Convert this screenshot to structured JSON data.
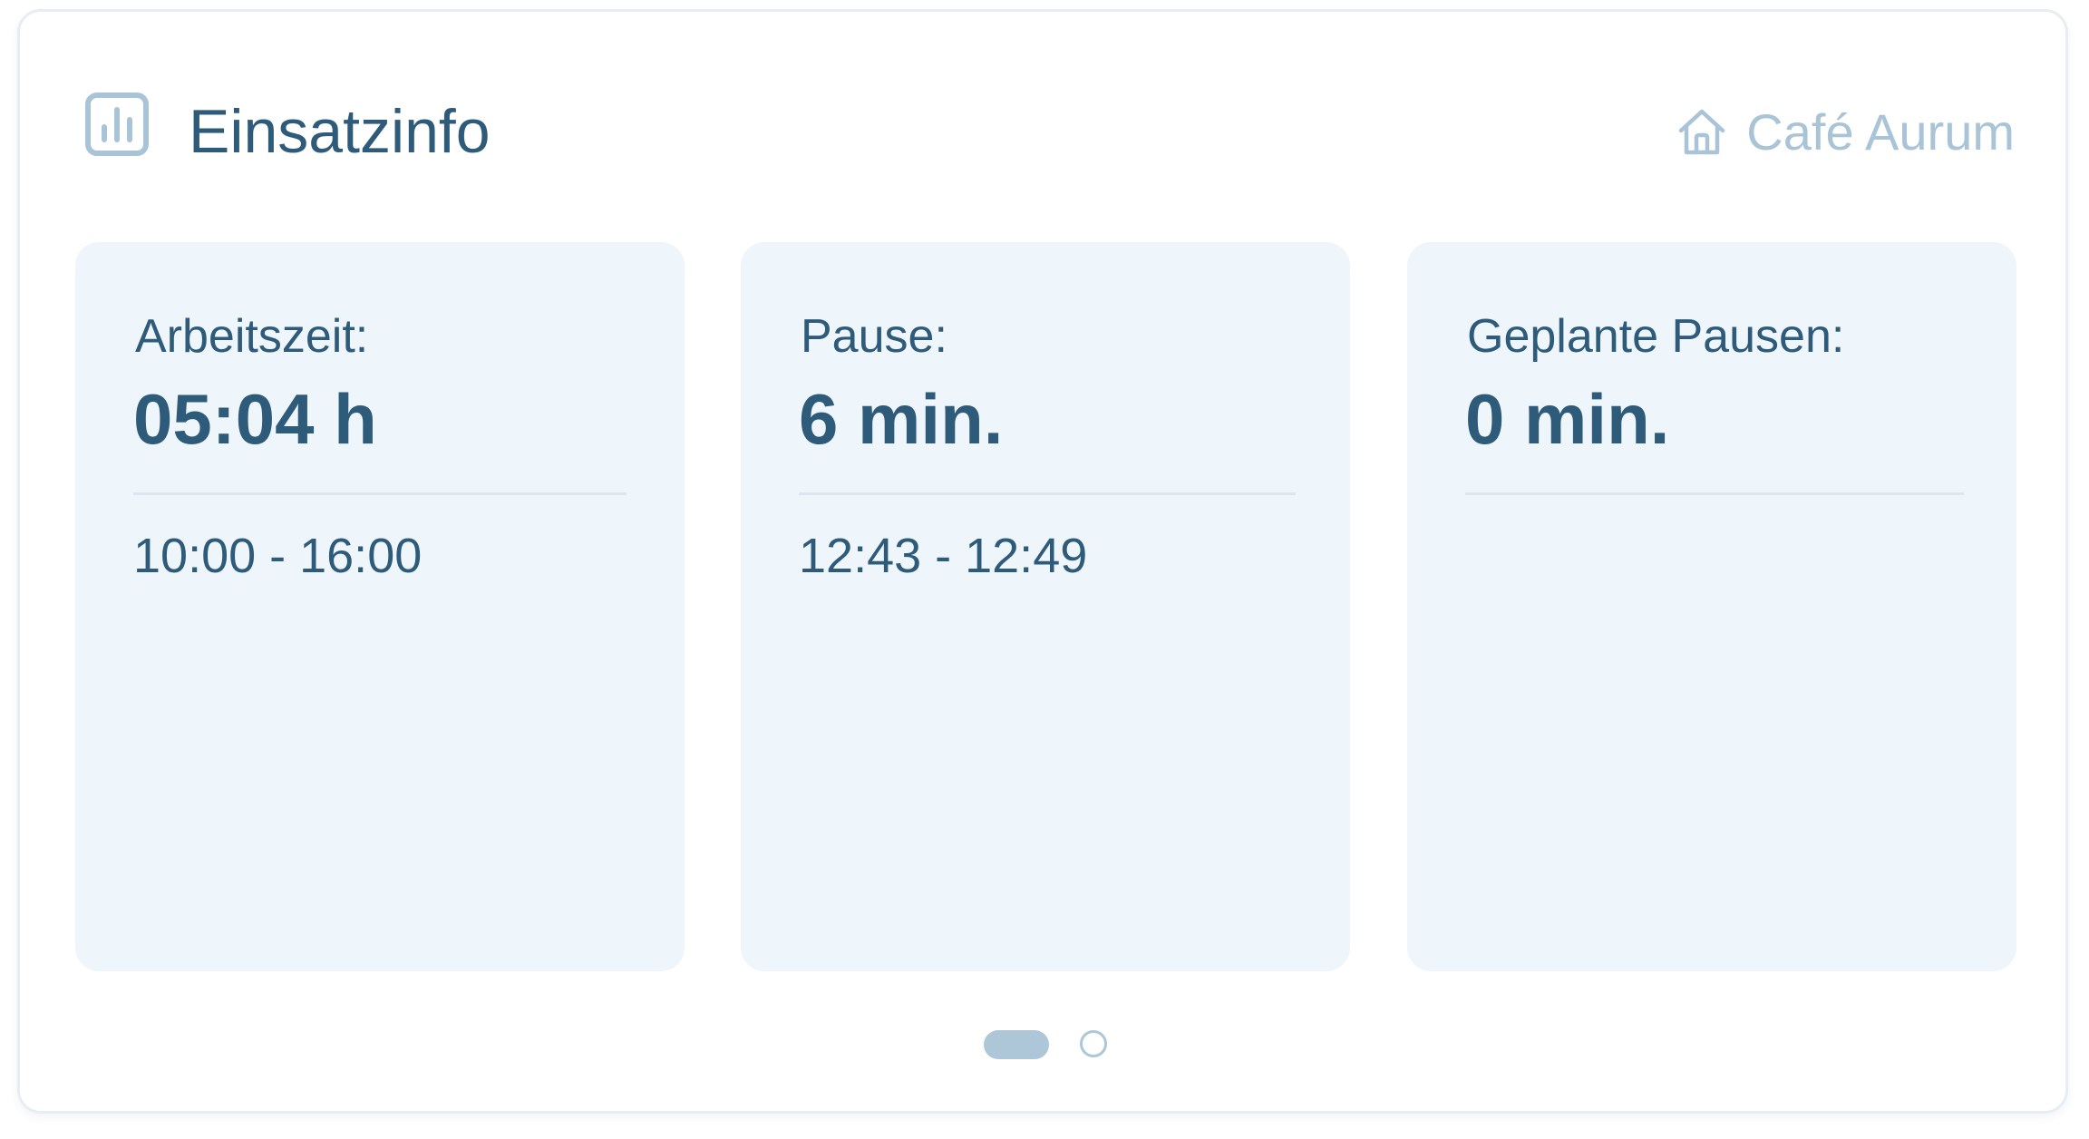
{
  "header": {
    "title": "Einsatzinfo",
    "title_icon": "bar-chart-icon",
    "location_icon": "home-icon",
    "location": "Café Aurum"
  },
  "tiles": [
    {
      "label": "Arbeitszeit:",
      "value": "05:04 h",
      "range": "10:00 - 16:00"
    },
    {
      "label": "Pause:",
      "value": "6 min.",
      "range": "12:43 - 12:49"
    },
    {
      "label": "Geplante Pausen:",
      "value": "0 min.",
      "range": ""
    }
  ],
  "pager": {
    "pages": 2,
    "active_page": 1
  },
  "colors": {
    "primary_text": "#2f5b7a",
    "muted": "#a9c4d6",
    "tile_background": "#eef5fb",
    "pager_active": "#adc7d8"
  }
}
